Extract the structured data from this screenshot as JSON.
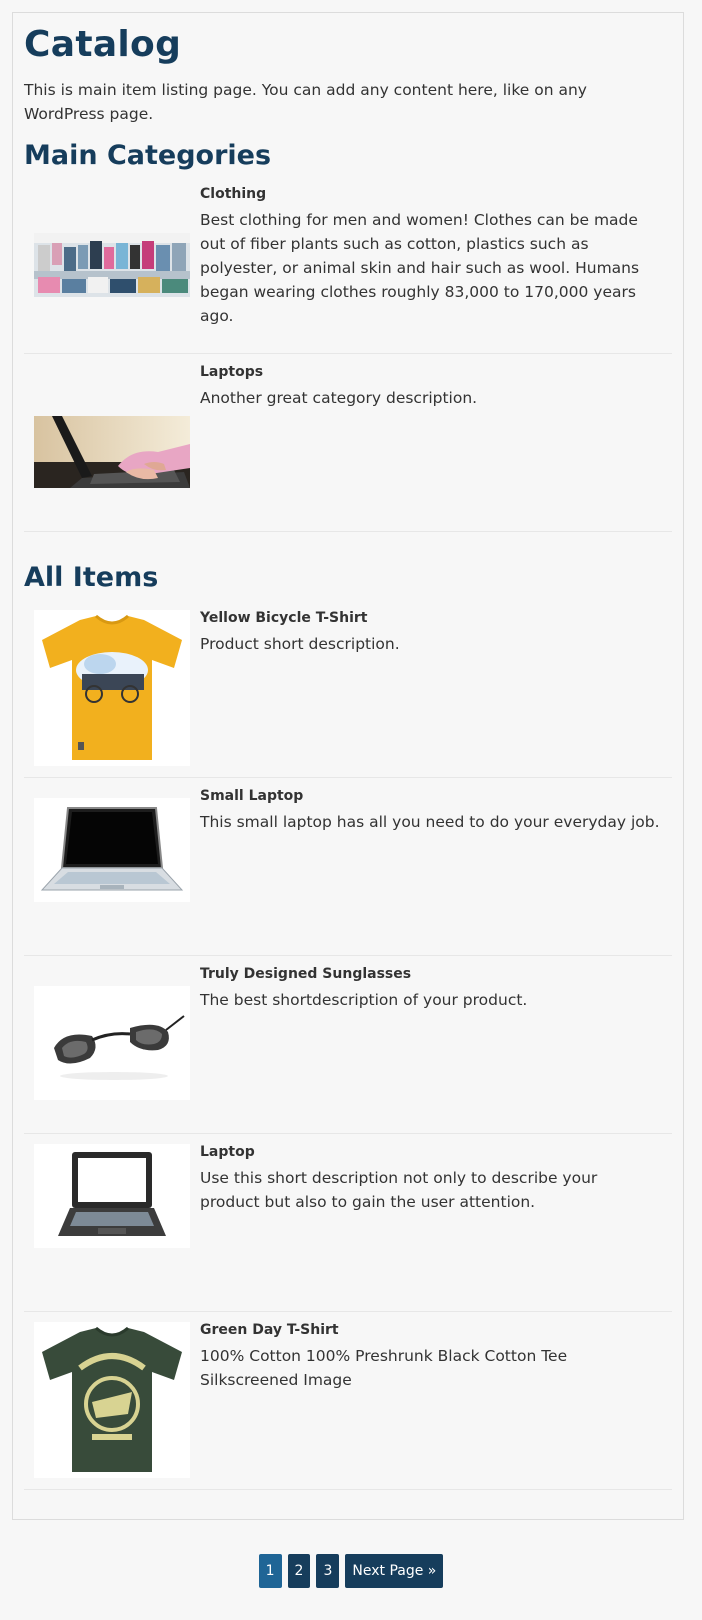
{
  "page": {
    "title": "Catalog",
    "intro": "This is main item listing page. You can add any content here, like on any WordPress page."
  },
  "categories": {
    "heading": "Main Categories",
    "items": [
      {
        "name": "Clothing",
        "description": "Best clothing for men and women! Clothes can be made out of fiber plants such as cotton, plastics such as polyester, or animal skin and hair such as wool. Humans began wearing clothes roughly 83,000 to 170,000 years ago.",
        "image": "clothing-store-photo"
      },
      {
        "name": "Laptops",
        "description": "Another great category description.",
        "image": "hands-typing-laptop-photo"
      }
    ]
  },
  "items": {
    "heading": "All Items",
    "list": [
      {
        "name": "Yellow Bicycle T-Shirt",
        "description": "Product short description.",
        "image": "yellow-tshirt-photo"
      },
      {
        "name": "Small Laptop",
        "description": "This small laptop has all you need to do your everyday job.",
        "image": "small-laptop-photo"
      },
      {
        "name": "Truly Designed Sunglasses",
        "description": "The best shortdescription of your product.",
        "image": "sunglasses-photo"
      },
      {
        "name": "Laptop",
        "description": "Use this short description not only to describe your product but also to gain the user attention.",
        "image": "laptop-photo"
      },
      {
        "name": "Green Day T-Shirt",
        "description": "100% Cotton 100% Preshrunk Black Cotton Tee Silkscreened Image",
        "image": "green-day-tshirt-photo"
      }
    ]
  },
  "pagination": {
    "pages": [
      "1",
      "2",
      "3"
    ],
    "current": "1",
    "next_label": "Next Page »"
  },
  "colors": {
    "heading": "#163d5c",
    "button": "#163d5c",
    "button_active": "#1f6596",
    "background": "#f7f7f7"
  }
}
